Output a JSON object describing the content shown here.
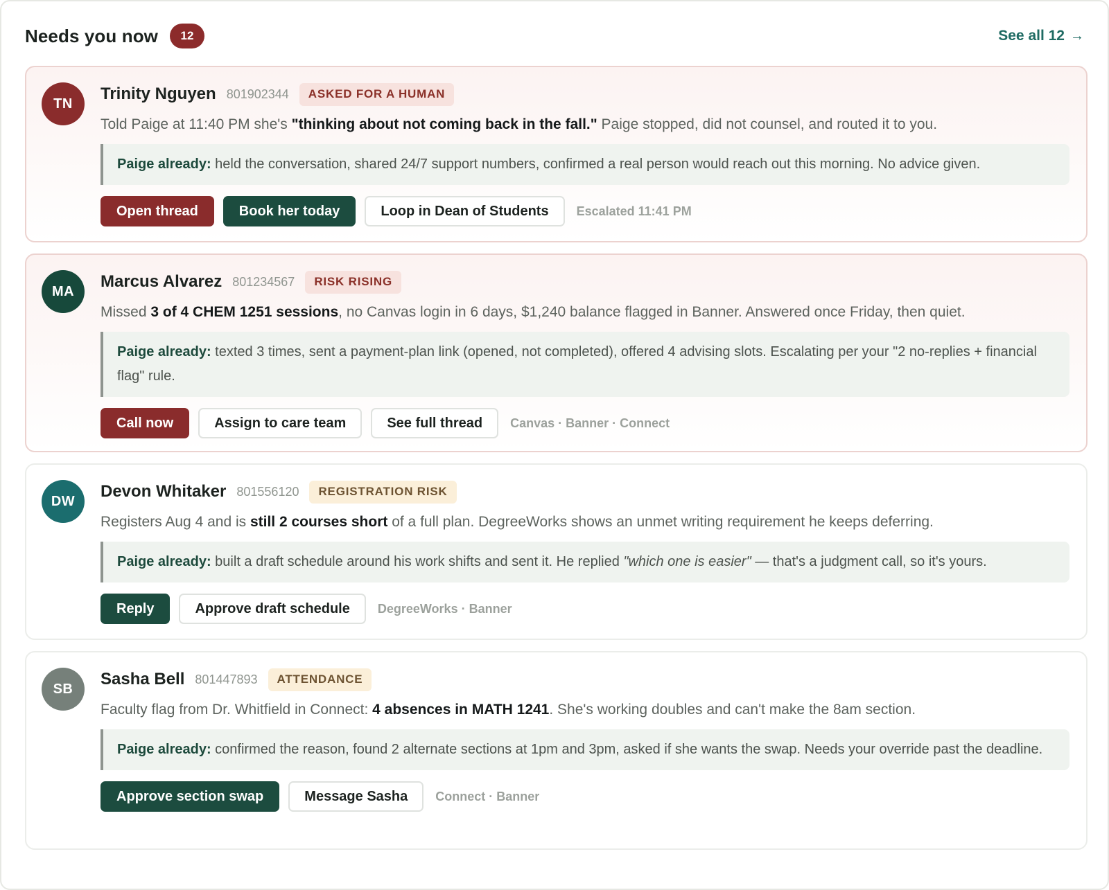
{
  "header": {
    "title": "Needs you now",
    "count": "12",
    "see_all": "See all 12",
    "see_all_arrow": "→"
  },
  "colors": {
    "accent_red": "#8a2c2c",
    "accent_green": "#1c4c3f",
    "link_teal": "#1f6b63"
  },
  "cards": [
    {
      "initials": "TN",
      "avatar_color": "#8a2c2c",
      "name": "Trinity Nguyen",
      "id": "801902344",
      "tag": "ASKED FOR A HUMAN",
      "summary": {
        "a": "Told Paige at 11:40 PM she's ",
        "b": "\"thinking about not coming back in the fall.\"",
        "c": " Paige stopped, did not counsel, and routed it to you."
      },
      "already_label": "Paige already:",
      "already_text": " held the conversation, shared 24/7 support numbers, confirmed a real person would reach out this morning. No advice given.",
      "actions": [
        "Open thread",
        "Book her today",
        "Loop in Dean of Students"
      ],
      "meta": "Escalated 11:41 PM"
    },
    {
      "initials": "MA",
      "avatar_color": "#17493b",
      "name": "Marcus Alvarez",
      "id": "801234567",
      "tag": "RISK RISING",
      "summary": {
        "a": "Missed ",
        "b": "3 of 4 CHEM 1251 sessions",
        "c": ", no Canvas login in 6 days, $1,240 balance flagged in Banner. Answered once Friday, then quiet."
      },
      "already_label": "Paige already:",
      "already_text": " texted 3 times, sent a payment-plan link (opened, not completed), offered 4 advising slots. Escalating per your \"2 no-replies + financial flag\" rule.",
      "actions": [
        "Call now",
        "Assign to care team",
        "See full thread"
      ],
      "meta": "Canvas · Banner · Connect"
    },
    {
      "initials": "DW",
      "avatar_color": "#1b6d6e",
      "name": "Devon Whitaker",
      "id": "801556120",
      "tag": "REGISTRATION RISK",
      "summary": {
        "a": "Registers Aug 4 and is ",
        "b": "still 2 courses short",
        "c": " of a full plan. DegreeWorks shows an unmet writing requirement he keeps deferring."
      },
      "already_label": "Paige already:",
      "already_text_a": " built a draft schedule around his work shifts and sent it. He replied ",
      "already_text_quote": "\"which one is easier\"",
      "already_text_b": " — that's a judgment call, so it's yours.",
      "actions": [
        "Reply",
        "Approve draft schedule"
      ],
      "meta": "DegreeWorks · Banner"
    },
    {
      "initials": "SB",
      "avatar_color": "#76807a",
      "name": "Sasha Bell",
      "id": "801447893",
      "tag": "ATTENDANCE",
      "summary": {
        "a": "Faculty flag from Dr. Whitfield in Connect: ",
        "b": "4 absences in MATH 1241",
        "c": ". She's working doubles and can't make the 8am section."
      },
      "already_label": "Paige already:",
      "already_text": " confirmed the reason, found 2 alternate sections at 1pm and 3pm, asked if she wants the swap. Needs your override past the deadline.",
      "actions": [
        "Approve section swap",
        "Message Sasha"
      ],
      "meta": "Connect · Banner"
    }
  ]
}
